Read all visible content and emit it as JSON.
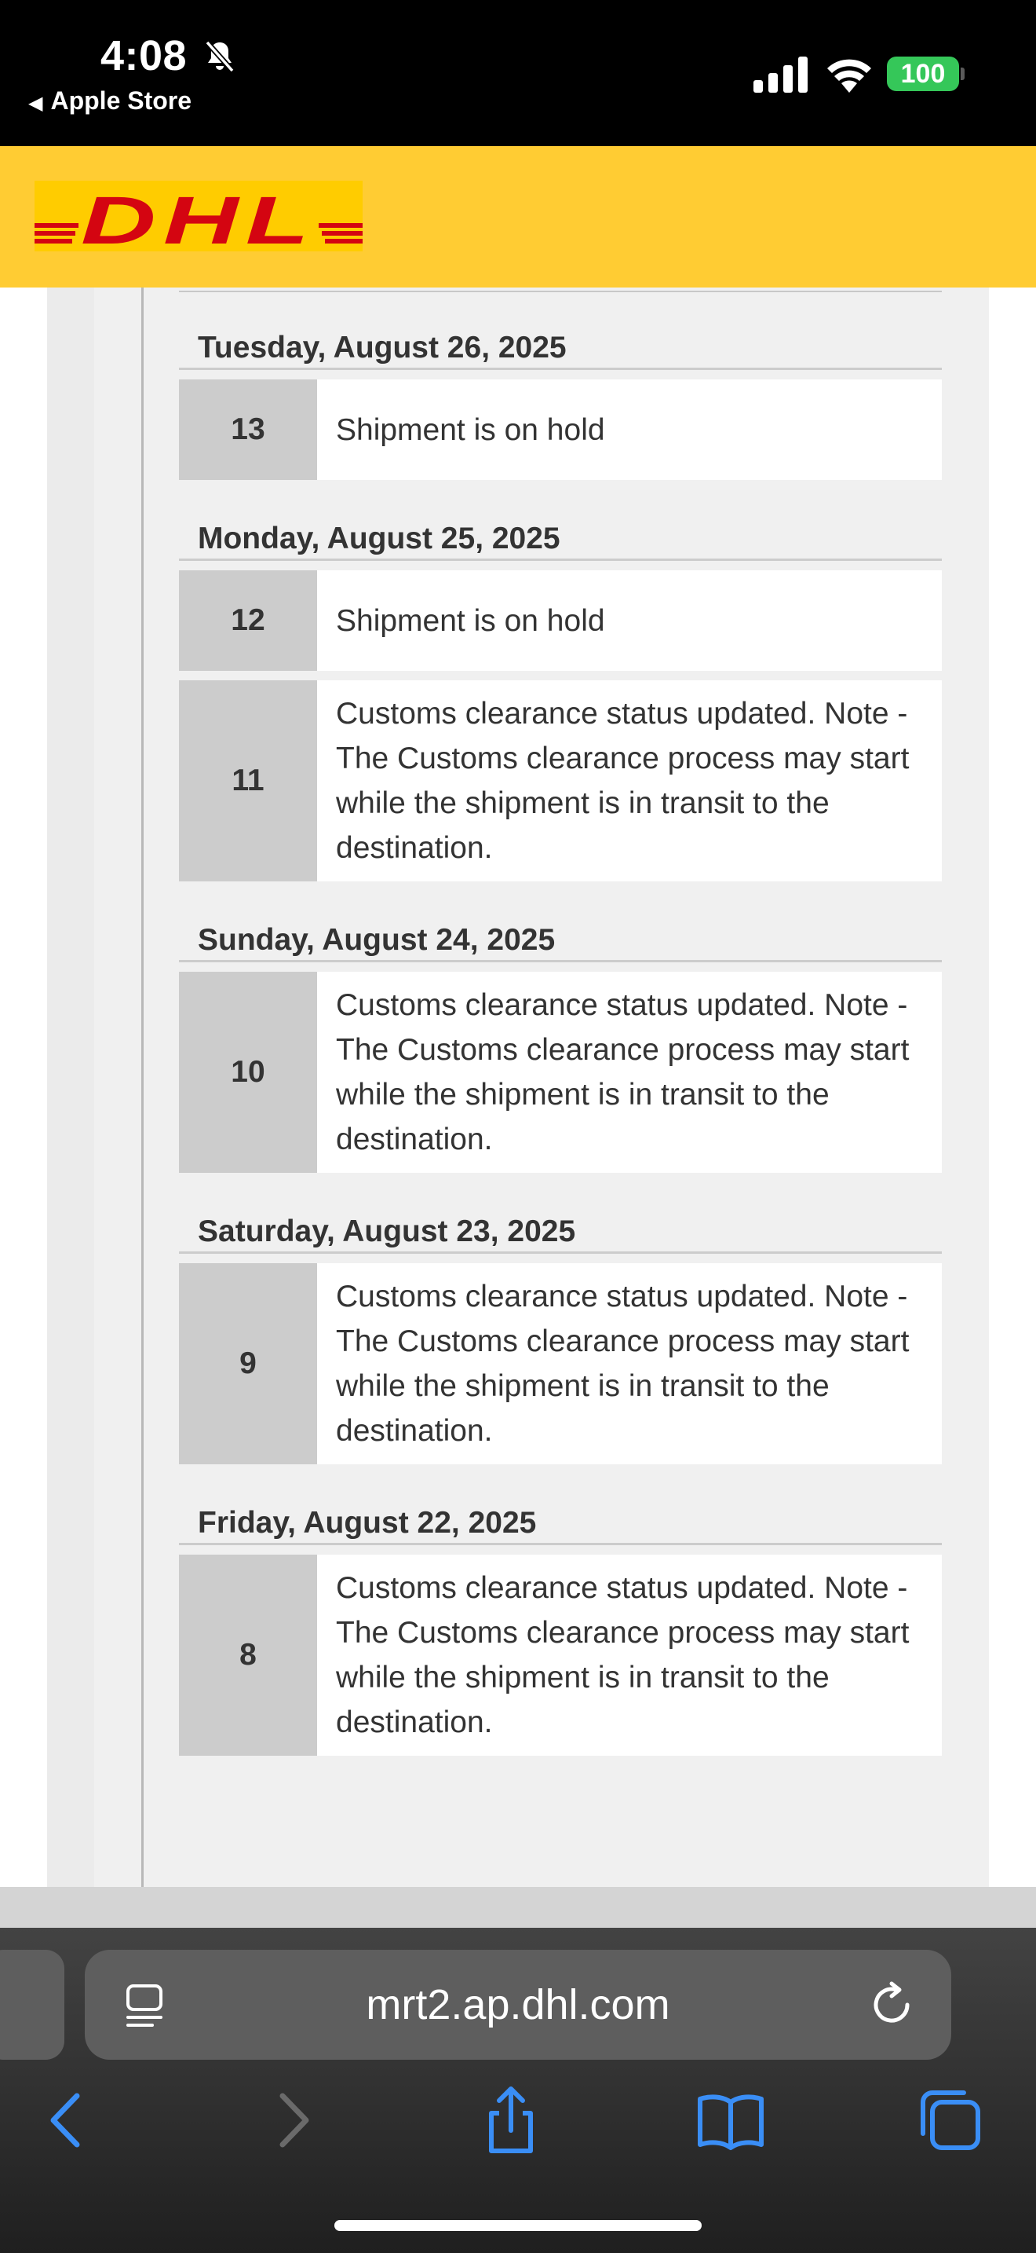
{
  "status_bar": {
    "time": "4:08",
    "back_app": "Apple Store",
    "battery": "100",
    "battery_color": "#35c759"
  },
  "header": {
    "logo_text": "DHL",
    "brand_yellow": "#ffcc33",
    "brand_red": "#d40511"
  },
  "events": [
    {
      "date": "Tuesday, August 26, 2025",
      "items": [
        {
          "number": "13",
          "description": "Shipment is on hold"
        }
      ]
    },
    {
      "date": "Monday, August 25, 2025",
      "items": [
        {
          "number": "12",
          "description": "Shipment is on hold"
        },
        {
          "number": "11",
          "description": "Customs clearance status updated. Note - The Customs clearance process may start while the shipment is in transit to the destination."
        }
      ]
    },
    {
      "date": "Sunday, August 24, 2025",
      "items": [
        {
          "number": "10",
          "description": "Customs clearance status updated. Note - The Customs clearance process may start while the shipment is in transit to the destination."
        }
      ]
    },
    {
      "date": "Saturday, August 23, 2025",
      "items": [
        {
          "number": "9",
          "description": "Customs clearance status updated. Note - The Customs clearance process may start while the shipment is in transit to the destination."
        }
      ]
    },
    {
      "date": "Friday, August 22, 2025",
      "items": [
        {
          "number": "8",
          "description": "Customs clearance status updated. Note - The Customs clearance process may start while the shipment is in transit to the destination."
        }
      ]
    }
  ],
  "browser": {
    "url": "mrt2.ap.dhl.com",
    "accent": "#3a8ef6",
    "icons": [
      "page-menu-icon",
      "reload-icon",
      "back-icon",
      "forward-icon",
      "share-icon",
      "bookmarks-icon",
      "tabs-icon"
    ]
  }
}
